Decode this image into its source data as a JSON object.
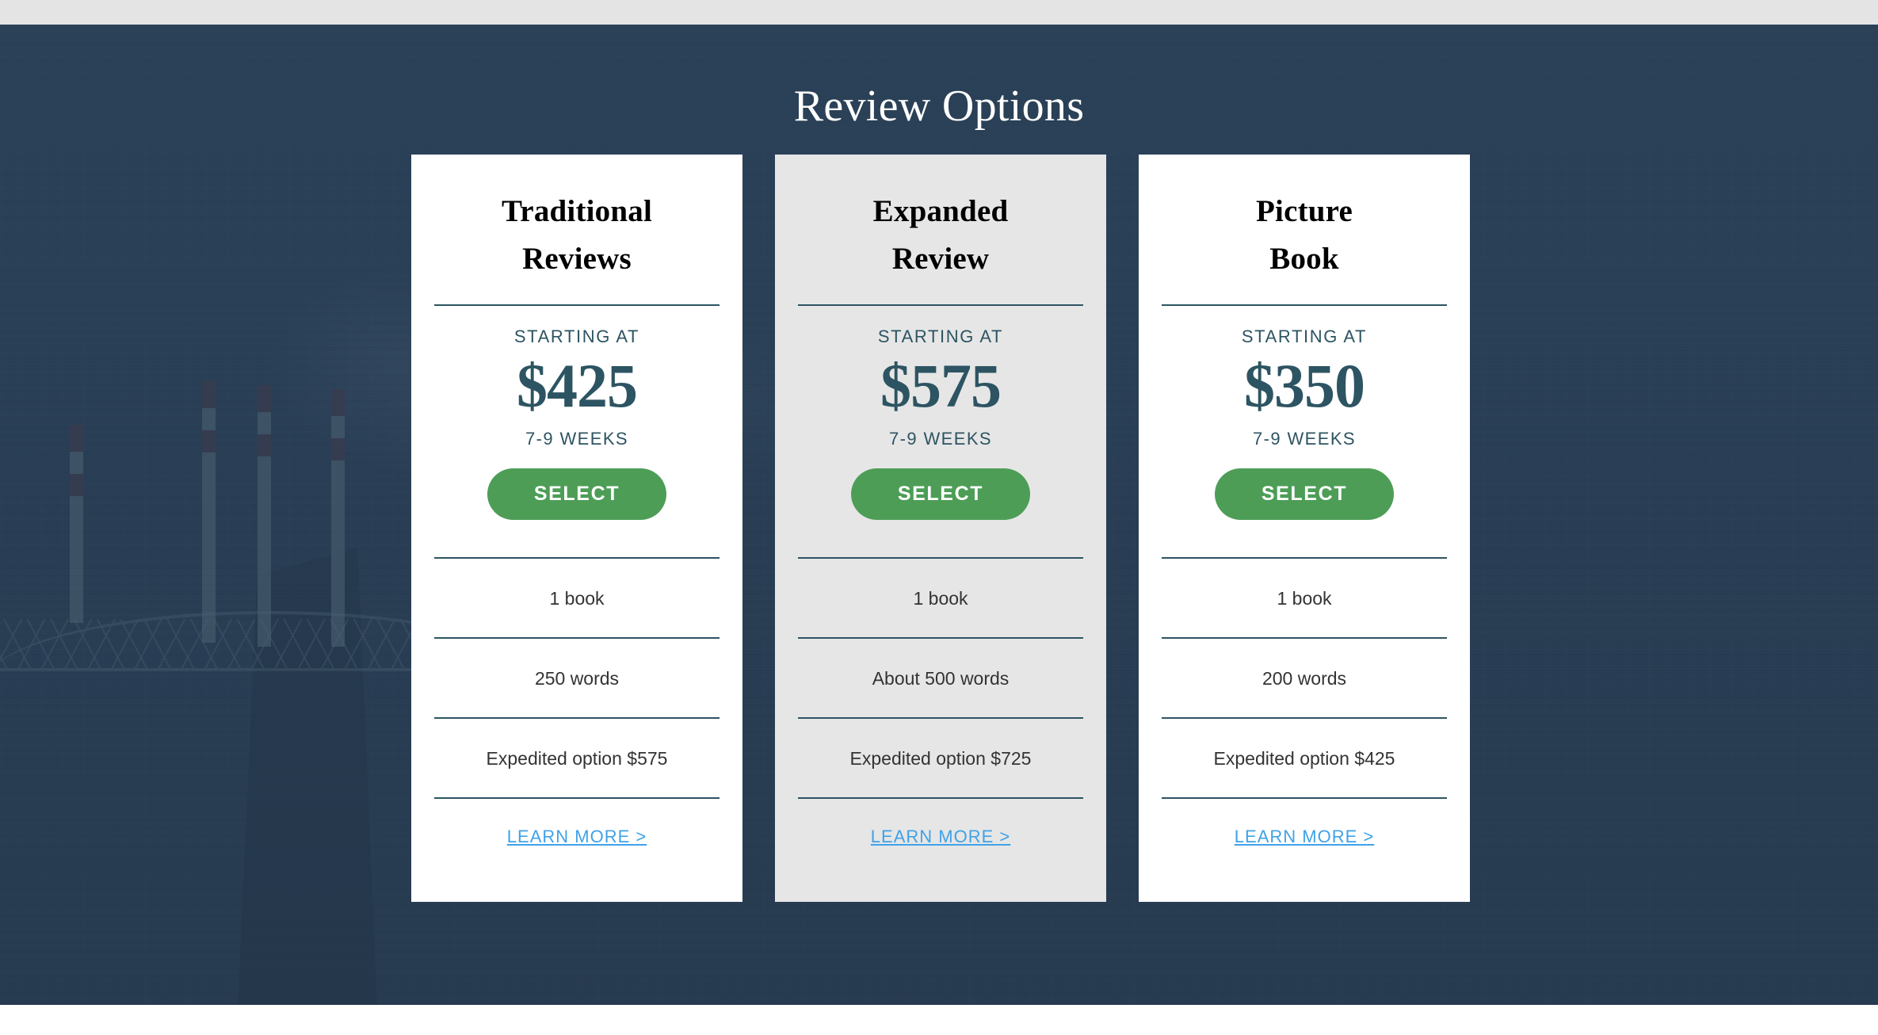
{
  "hero": {
    "title": "Review Options",
    "background_color": "#2b4257",
    "top_strip_color": "#e4e4e4",
    "background_scene": "city-skyline-photo"
  },
  "theme": {
    "accent_teal": "#2d5462",
    "select_green": "#4d9d57",
    "link_blue": "#3fa2e8",
    "featured_card_bg": "#e6e6e6",
    "card_bg": "#ffffff"
  },
  "cards": [
    {
      "title_line1": "Traditional",
      "title_line2": "Reviews",
      "starting_at_label": "STARTING AT",
      "price": "$425",
      "turnaround": "7-9 WEEKS",
      "select_label": "SELECT",
      "features": [
        "1 book",
        "250 words",
        "Expedited option $575"
      ],
      "learn_more_label": "LEARN MORE >",
      "featured": false
    },
    {
      "title_line1": "Expanded",
      "title_line2": "Review",
      "starting_at_label": "STARTING AT",
      "price": "$575",
      "turnaround": "7-9 WEEKS",
      "select_label": "SELECT",
      "features": [
        "1 book",
        "About 500 words",
        "Expedited option $725"
      ],
      "learn_more_label": "LEARN MORE >",
      "featured": true
    },
    {
      "title_line1": "Picture",
      "title_line2": "Book",
      "starting_at_label": "STARTING AT",
      "price": "$350",
      "turnaround": "7-9 WEEKS",
      "select_label": "SELECT",
      "features": [
        "1 book",
        "200 words",
        "Expedited option $425"
      ],
      "learn_more_label": "LEARN MORE >",
      "featured": false
    }
  ]
}
